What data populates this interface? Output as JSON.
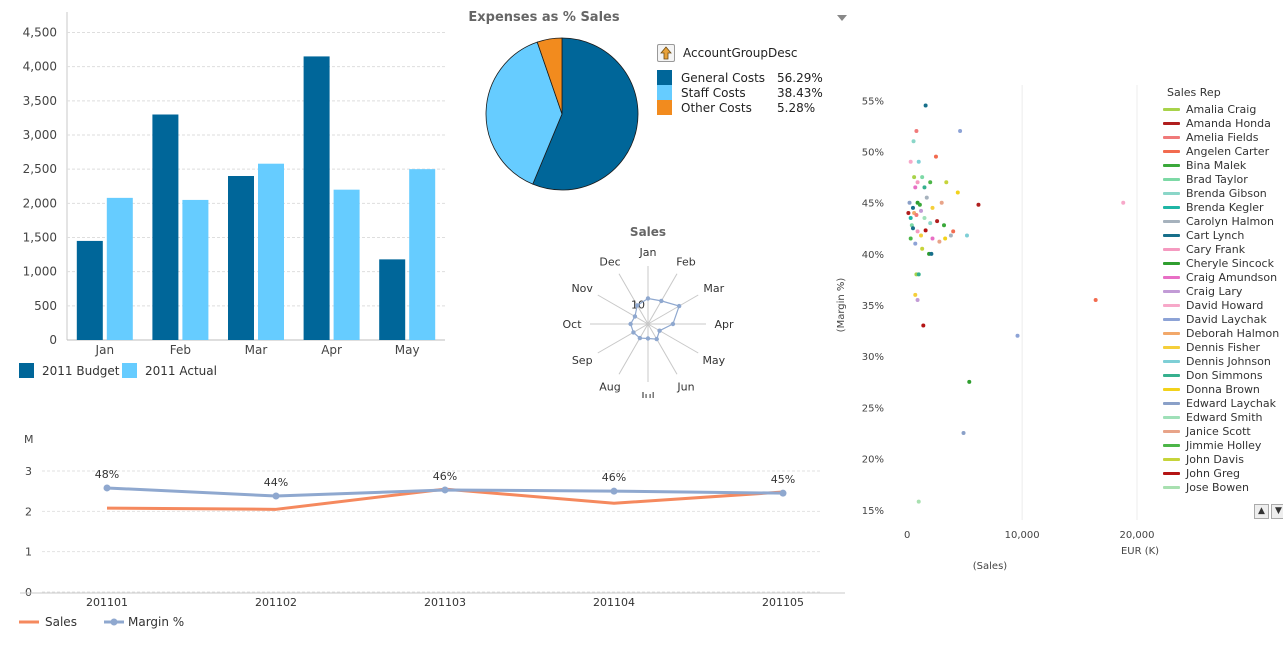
{
  "chart_data": [
    {
      "type": "bar",
      "title": "",
      "categories": [
        "Jan",
        "Feb",
        "Mar",
        "Apr",
        "May"
      ],
      "series": [
        {
          "name": "2011 Budget",
          "values": [
            1450,
            3300,
            2400,
            4150,
            1180
          ],
          "color": "#006699"
        },
        {
          "name": "2011 Actual",
          "values": [
            2080,
            2050,
            2580,
            2200,
            2500
          ],
          "color": "#66ccff"
        }
      ],
      "ylim": [
        0,
        4800
      ],
      "yticks": [
        "0",
        "500",
        "1,000",
        "1,500",
        "2,000",
        "2,500",
        "3,000",
        "3,500",
        "4,000",
        "4,500"
      ],
      "grid": true,
      "legend": "bottom-left"
    },
    {
      "type": "pie",
      "title": "Expenses as % Sales",
      "legend_title": "AccountGroupDesc",
      "slices": [
        {
          "label": "General Costs",
          "value": 56.29,
          "pct": "56.29%",
          "color": "#006699"
        },
        {
          "label": "Staff Costs",
          "value": 38.43,
          "pct": "38.43%",
          "color": "#66ccff"
        },
        {
          "label": "Other Costs",
          "value": 5.28,
          "pct": "5.28%",
          "color": "#f28b1e"
        }
      ]
    },
    {
      "type": "radar",
      "title": "Sales",
      "categories": [
        "Jan",
        "Feb",
        "Mar",
        "Apr",
        "May",
        "Jun",
        "Jul",
        "Aug",
        "Sep",
        "Oct",
        "Nov",
        "Dec"
      ],
      "values": [
        4.4,
        4.6,
        6.2,
        4.3,
        2.3,
        3.0,
        2.5,
        2.8,
        2.9,
        3.0,
        2.6,
        3.7
      ],
      "tick_label": "10",
      "color": "#8fa8cf"
    },
    {
      "type": "line",
      "title": "",
      "ylabel": "M",
      "x": [
        "201101",
        "201102",
        "201103",
        "201104",
        "201105"
      ],
      "series": [
        {
          "name": "Sales",
          "values": [
            2.08,
            2.05,
            2.55,
            2.2,
            2.48
          ],
          "color": "#f5895e"
        },
        {
          "name": "Margin %",
          "values": [
            2.58,
            2.38,
            2.53,
            2.5,
            2.45
          ],
          "labels": [
            "48%",
            "44%",
            "46%",
            "46%",
            "45%"
          ],
          "color": "#8fa8cf"
        }
      ],
      "ylim": [
        0,
        3
      ],
      "yticks": [
        "0",
        "1",
        "2",
        "3"
      ],
      "grid": true,
      "legend": "bottom-left"
    },
    {
      "type": "scatter",
      "title": "",
      "xlabel": "(Sales)",
      "x_unit": "EUR (K)",
      "ylabel": "(Margin %)",
      "xlim": [
        -1500,
        22000
      ],
      "ylim": [
        14,
        56.5
      ],
      "xticks": [
        {
          "v": 0,
          "t": "0"
        },
        {
          "v": 10000,
          "t": "10,000"
        },
        {
          "v": 20000,
          "t": "20,000"
        }
      ],
      "yticks": [
        {
          "v": 15,
          "t": "15%"
        },
        {
          "v": 20,
          "t": "20%"
        },
        {
          "v": 25,
          "t": "25%"
        },
        {
          "v": 30,
          "t": "30%"
        },
        {
          "v": 35,
          "t": "35%"
        },
        {
          "v": 40,
          "t": "40%"
        },
        {
          "v": 45,
          "t": "45%"
        },
        {
          "v": 50,
          "t": "50%"
        },
        {
          "v": 55,
          "t": "55%"
        }
      ],
      "legend_title": "Sales Rep",
      "legend_items": [
        {
          "name": "Amalia Craig",
          "color": "#a8d34a"
        },
        {
          "name": "Amanda Honda",
          "color": "#b01e1e"
        },
        {
          "name": "Amelia Fields",
          "color": "#f07a7a"
        },
        {
          "name": "Angelen Carter",
          "color": "#f26b4f"
        },
        {
          "name": "Bina Malek",
          "color": "#3aa83a"
        },
        {
          "name": "Brad Taylor",
          "color": "#7dd9a6"
        },
        {
          "name": "Brenda Gibson",
          "color": "#8ad6c8"
        },
        {
          "name": "Brenda Kegler",
          "color": "#1fb5a5"
        },
        {
          "name": "Carolyn Halmon",
          "color": "#a6b2bd"
        },
        {
          "name": "Cart Lynch",
          "color": "#176f8a"
        },
        {
          "name": "Cary Frank",
          "color": "#f59ac0"
        },
        {
          "name": "Cheryle Sincock",
          "color": "#2f9e2f"
        },
        {
          "name": "Craig Amundson",
          "color": "#e86fc5"
        },
        {
          "name": "Craig Lary",
          "color": "#c29bd6"
        },
        {
          "name": "David Howard",
          "color": "#f7a8c9"
        },
        {
          "name": "David Laychak",
          "color": "#8da3d6"
        },
        {
          "name": "Deborah Halmon",
          "color": "#f2a86a"
        },
        {
          "name": "Dennis Fisher",
          "color": "#f5cf3a"
        },
        {
          "name": "Dennis Johnson",
          "color": "#7ecfd6"
        },
        {
          "name": "Don Simmons",
          "color": "#36b08e"
        },
        {
          "name": "Donna Brown",
          "color": "#f2d21b"
        },
        {
          "name": "Edward Laychak",
          "color": "#8aa0c8"
        },
        {
          "name": "Edward Smith",
          "color": "#9fe0b8"
        },
        {
          "name": "Janice Scott",
          "color": "#e8a489"
        },
        {
          "name": "Jimmie Holley",
          "color": "#4cb548"
        },
        {
          "name": "John Davis",
          "color": "#c6d43a"
        },
        {
          "name": "John Greg",
          "color": "#b41414"
        },
        {
          "name": "Jose Bowen",
          "color": "#a8e0b0"
        }
      ],
      "points": [
        {
          "x": 550,
          "y": 51,
          "c": 6
        },
        {
          "x": 1600,
          "y": 54.5,
          "c": 9
        },
        {
          "x": 800,
          "y": 52,
          "c": 2
        },
        {
          "x": 300,
          "y": 49,
          "c": 14
        },
        {
          "x": 1000,
          "y": 49,
          "c": 18
        },
        {
          "x": 2500,
          "y": 49.5,
          "c": 3
        },
        {
          "x": 4600,
          "y": 52,
          "c": 15
        },
        {
          "x": 600,
          "y": 47.5,
          "c": 0
        },
        {
          "x": 900,
          "y": 47,
          "c": 10
        },
        {
          "x": 1300,
          "y": 47.5,
          "c": 5
        },
        {
          "x": 700,
          "y": 46.5,
          "c": 12
        },
        {
          "x": 1500,
          "y": 46.5,
          "c": 19
        },
        {
          "x": 2000,
          "y": 47,
          "c": 24
        },
        {
          "x": 3400,
          "y": 47,
          "c": 25
        },
        {
          "x": 4400,
          "y": 46,
          "c": 20
        },
        {
          "x": 200,
          "y": 45,
          "c": 21
        },
        {
          "x": 500,
          "y": 44.5,
          "c": 9
        },
        {
          "x": 900,
          "y": 45,
          "c": 11
        },
        {
          "x": 1100,
          "y": 44.8,
          "c": 4
        },
        {
          "x": 1700,
          "y": 45.5,
          "c": 8
        },
        {
          "x": 2200,
          "y": 44.5,
          "c": 17
        },
        {
          "x": 3000,
          "y": 45,
          "c": 23
        },
        {
          "x": 6200,
          "y": 44.8,
          "c": 1
        },
        {
          "x": 18800,
          "y": 45,
          "c": 14
        },
        {
          "x": 100,
          "y": 44,
          "c": 1
        },
        {
          "x": 300,
          "y": 43.5,
          "c": 7
        },
        {
          "x": 600,
          "y": 44,
          "c": 16
        },
        {
          "x": 800,
          "y": 43.8,
          "c": 2
        },
        {
          "x": 1200,
          "y": 44.2,
          "c": 13
        },
        {
          "x": 1500,
          "y": 43.5,
          "c": 22
        },
        {
          "x": 2000,
          "y": 43,
          "c": 6
        },
        {
          "x": 2600,
          "y": 43.2,
          "c": 1
        },
        {
          "x": 3200,
          "y": 42.8,
          "c": 4
        },
        {
          "x": 400,
          "y": 42.8,
          "c": 5
        },
        {
          "x": 500,
          "y": 42.5,
          "c": 9
        },
        {
          "x": 900,
          "y": 42.2,
          "c": 10
        },
        {
          "x": 1200,
          "y": 41.8,
          "c": 17
        },
        {
          "x": 1600,
          "y": 42.3,
          "c": 26
        },
        {
          "x": 2200,
          "y": 41.5,
          "c": 12
        },
        {
          "x": 3800,
          "y": 41.8,
          "c": 8
        },
        {
          "x": 4000,
          "y": 42.2,
          "c": 3
        },
        {
          "x": 5200,
          "y": 41.8,
          "c": 18
        },
        {
          "x": 300,
          "y": 41.5,
          "c": 24
        },
        {
          "x": 700,
          "y": 41,
          "c": 15
        },
        {
          "x": 1300,
          "y": 40.5,
          "c": 25
        },
        {
          "x": 2800,
          "y": 41.2,
          "c": 23
        },
        {
          "x": 3300,
          "y": 41.5,
          "c": 20
        },
        {
          "x": 1900,
          "y": 40,
          "c": 11
        },
        {
          "x": 2100,
          "y": 40,
          "c": 9
        },
        {
          "x": 800,
          "y": 38,
          "c": 0
        },
        {
          "x": 1000,
          "y": 38,
          "c": 19
        },
        {
          "x": 700,
          "y": 36,
          "c": 17
        },
        {
          "x": 900,
          "y": 35.5,
          "c": 13
        },
        {
          "x": 16400,
          "y": 35.5,
          "c": 3
        },
        {
          "x": 1400,
          "y": 33,
          "c": 26
        },
        {
          "x": 9600,
          "y": 32,
          "c": 15
        },
        {
          "x": 5400,
          "y": 27.5,
          "c": 11
        },
        {
          "x": 4900,
          "y": 22.5,
          "c": 21
        },
        {
          "x": 1000,
          "y": 15.8,
          "c": 27
        }
      ]
    }
  ],
  "ui": {
    "scroll_up": "▲",
    "scroll_down": "▼"
  }
}
